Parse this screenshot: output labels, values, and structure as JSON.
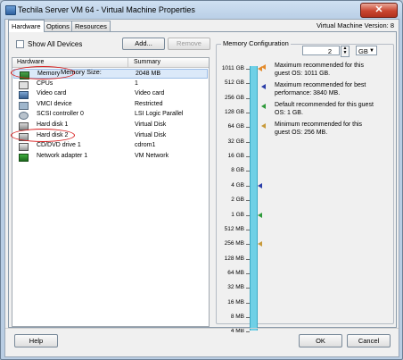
{
  "window": {
    "title": "Techila Server VM 64 - Virtual Machine Properties",
    "close_glyph": "✕"
  },
  "tabs": [
    {
      "label": "Hardware",
      "active": true
    },
    {
      "label": "Options",
      "active": false
    },
    {
      "label": "Resources",
      "active": false
    }
  ],
  "vm_version": "Virtual Machine Version: 8",
  "hardware": {
    "show_all_label": "Show All Devices",
    "add_label": "Add...",
    "remove_label": "Remove",
    "columns": [
      "Hardware",
      "Summary"
    ],
    "rows": [
      {
        "name": "Memory",
        "summary": "2048 MB",
        "icon": "memory-icon",
        "selected": true,
        "highlighted": true
      },
      {
        "name": "CPUs",
        "summary": "1",
        "icon": "cpu-icon",
        "selected": false,
        "highlighted": false
      },
      {
        "name": "Video card",
        "summary": "Video card",
        "icon": "video-card-icon",
        "selected": false,
        "highlighted": false
      },
      {
        "name": "VMCI device",
        "summary": "Restricted",
        "icon": "vmci-device-icon",
        "selected": false,
        "highlighted": false
      },
      {
        "name": "SCSI controller 0",
        "summary": "LSI Logic Parallel",
        "icon": "scsi-controller-icon",
        "selected": false,
        "highlighted": false
      },
      {
        "name": "Hard disk 1",
        "summary": "Virtual Disk",
        "icon": "hard-disk-icon",
        "selected": false,
        "highlighted": false
      },
      {
        "name": "Hard disk 2",
        "summary": "Virtual Disk",
        "icon": "hard-disk-icon",
        "selected": false,
        "highlighted": true
      },
      {
        "name": "CD/DVD drive 1",
        "summary": "cdrom1",
        "icon": "cd-dvd-icon",
        "selected": false,
        "highlighted": false
      },
      {
        "name": "Network adapter 1",
        "summary": "VM Network",
        "icon": "network-adapter-icon",
        "selected": false,
        "highlighted": false
      }
    ]
  },
  "memory": {
    "group_title": "Memory Configuration",
    "size_label": "Memory Size:",
    "size_value": "2",
    "unit": "GB",
    "scale": [
      "1011 GB",
      "512 GB",
      "256 GB",
      "128 GB",
      "64 GB",
      "32 GB",
      "16 GB",
      "8 GB",
      "4 GB",
      "2 GB",
      "1 GB",
      "512 MB",
      "256 MB",
      "128 MB",
      "64 MB",
      "32 MB",
      "16 MB",
      "8 MB",
      "4 MB"
    ],
    "markers": [
      {
        "color": "#e38a2b",
        "at": "1011 GB"
      },
      {
        "color": "#2a3da8",
        "at": "4 GB"
      },
      {
        "color": "#2e9a3a",
        "at": "1 GB"
      },
      {
        "color": "#c89a3a",
        "at": "256 MB"
      }
    ],
    "legend": [
      {
        "color": "#e38a2b",
        "text": "Maximum recommended for this guest OS: 1011 GB."
      },
      {
        "color": "#2a3da8",
        "text": "Maximum recommended for best performance: 3840 MB."
      },
      {
        "color": "#2e9a3a",
        "text": "Default recommended for this guest OS: 1 GB."
      },
      {
        "color": "#c89a3a",
        "text": "Minimum recommended for this guest OS: 256 MB."
      }
    ]
  },
  "footer": {
    "help_label": "Help",
    "ok_label": "OK",
    "cancel_label": "Cancel"
  }
}
